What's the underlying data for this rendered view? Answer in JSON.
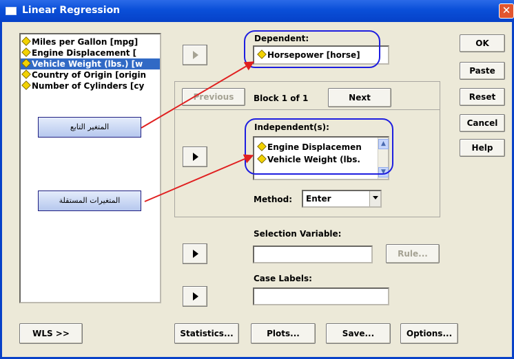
{
  "window": {
    "title": "Linear Regression"
  },
  "variables": [
    {
      "label": "Miles per Gallon [mpg]",
      "selected": false
    },
    {
      "label": "Engine Displacement [",
      "selected": false
    },
    {
      "label": "Vehicle Weight (lbs.) [w",
      "selected": true
    },
    {
      "label": "Country of Origin [origin",
      "selected": false
    },
    {
      "label": "Number of Cylinders [cy",
      "selected": false
    }
  ],
  "dependent": {
    "label": "Dependent:",
    "value": "Horsepower [horse]"
  },
  "block": {
    "previous": "Previous",
    "text": "Block 1 of 1",
    "next": "Next"
  },
  "independent": {
    "label": "Independent(s):",
    "items": [
      "Engine Displacemen",
      "Vehicle Weight (lbs."
    ]
  },
  "method": {
    "label": "Method:",
    "value": "Enter"
  },
  "selection": {
    "label": "Selection Variable:",
    "rule": "Rule..."
  },
  "case_labels": {
    "label": "Case Labels:"
  },
  "side_buttons": {
    "ok": "OK",
    "paste": "Paste",
    "reset": "Reset",
    "cancel": "Cancel",
    "help": "Help"
  },
  "bottom_buttons": {
    "wls": "WLS >>",
    "statistics": "Statistics...",
    "plots": "Plots...",
    "save": "Save...",
    "options": "Options..."
  },
  "annotations": {
    "dependent_note": "المتغير التابع",
    "independent_note": "المتغيرات المستقلة"
  },
  "colors": {
    "highlight_oval": "#1d1de0",
    "arrow": "#e02020",
    "selection": "#316AC5"
  }
}
